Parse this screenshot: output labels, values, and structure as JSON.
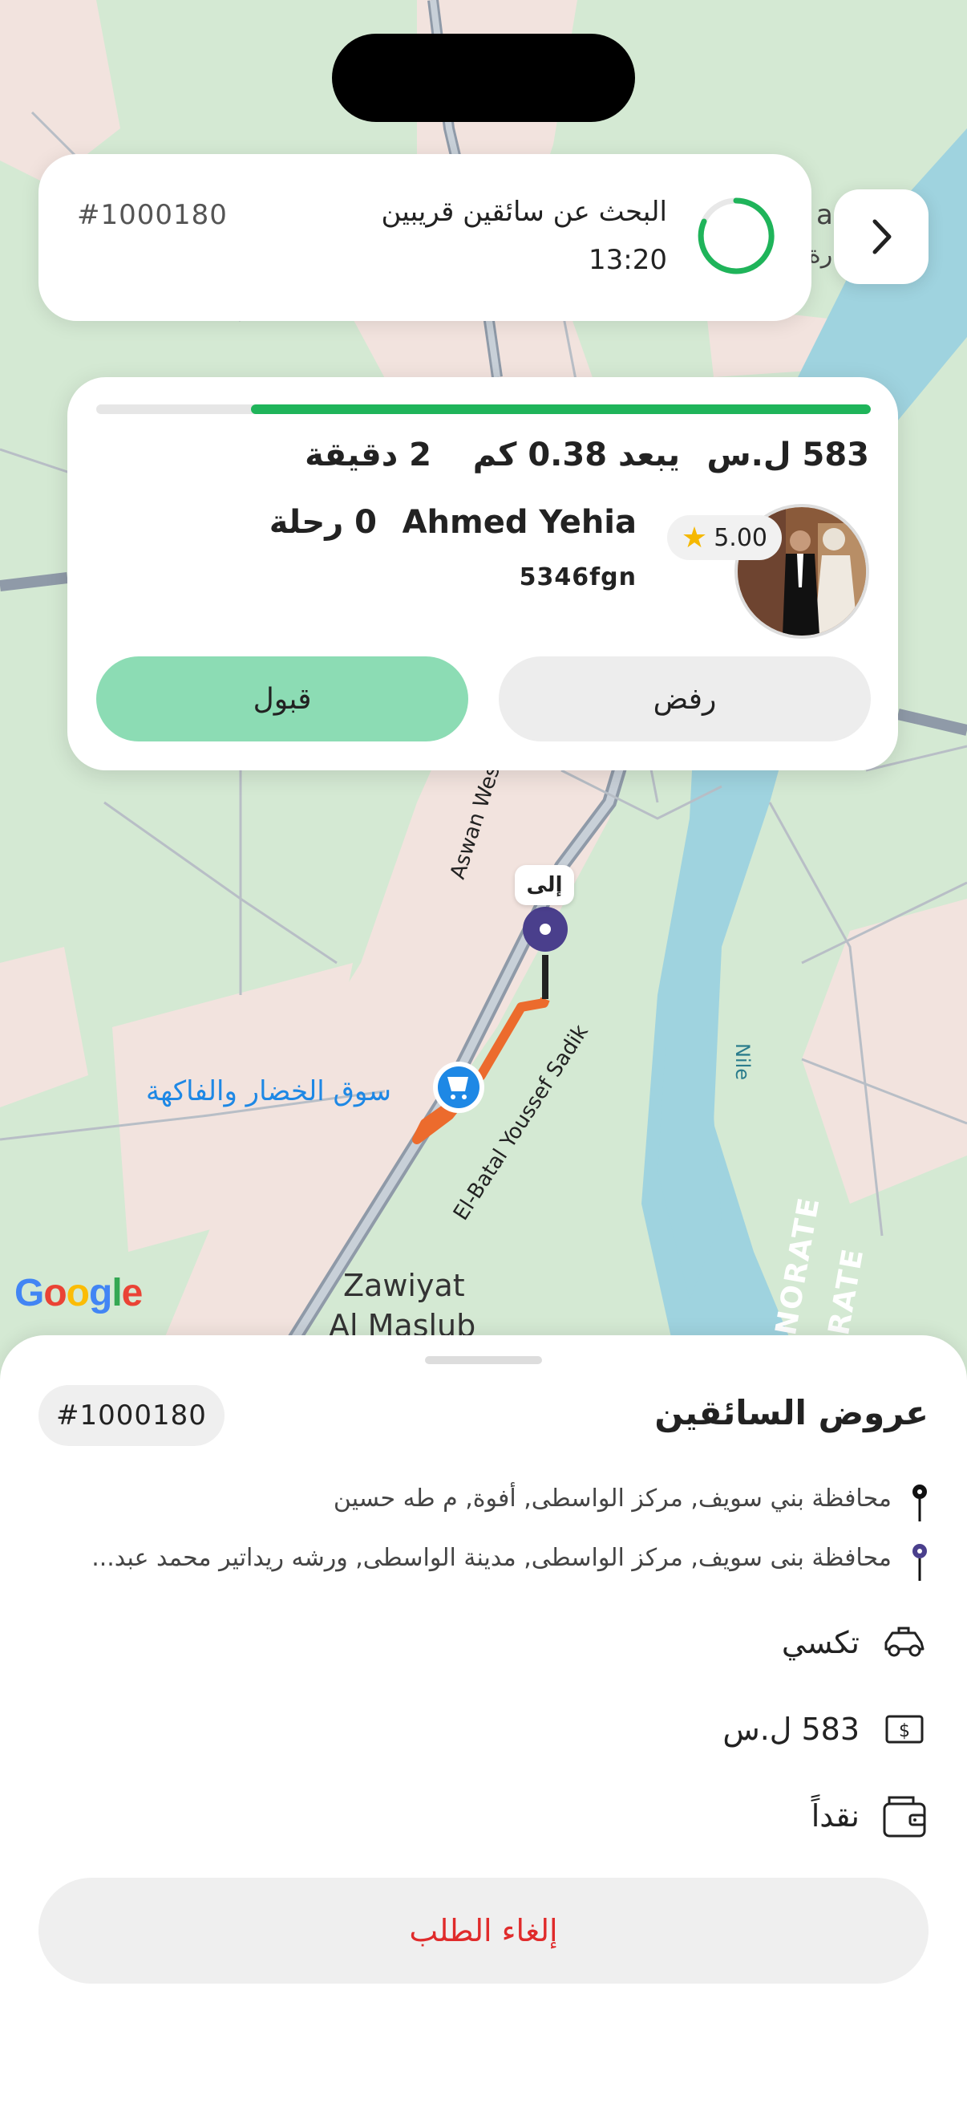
{
  "map": {
    "labels": {
      "road_west": "Aswan Western Agricu",
      "road_east": "El-Batal Youssef Sadik",
      "river": "Nile",
      "market": "سوق الخضار والفاكهة",
      "town_line1": "Zawiyat",
      "town_line2": "Al Maslub",
      "gov_1": "NORATE",
      "gov_2": "RATE",
      "edge_1": "a",
      "edge_2": "رة"
    },
    "dest_label": "إلى",
    "google_logo": [
      "G",
      "o",
      "o",
      "g",
      "l",
      "e"
    ],
    "google_colors": [
      "#4285F4",
      "#EA4335",
      "#FBBC05",
      "#4285F4",
      "#34A853",
      "#EA4335"
    ],
    "colors": {
      "land": "#d4e9d3",
      "urban": "#f2e3de",
      "water": "#9fd3df",
      "route": "#ec6b2d",
      "pin": "#4a3f8c"
    }
  },
  "search_card": {
    "order_id": "#1000180",
    "title": "البحث عن سائقين قريبين",
    "time": "13:20",
    "spinner_color": "#1fb45a"
  },
  "back_button": {
    "icon": "chevron-right-icon"
  },
  "offer": {
    "progress": 0.8,
    "price": "583 ل.س",
    "distance": "يبعد 0.38 كم",
    "eta": "2 دقيقة",
    "driver_name": "Ahmed Yehia",
    "trips": "0 رحلة",
    "plate": "5346fgn",
    "rating": "5.00",
    "reject_label": "رفض",
    "accept_label": "قبول",
    "accept_color": "#8cdcb4"
  },
  "sheet": {
    "title": "عروض السائقين",
    "order_id": "#1000180",
    "pickup_address": "محافظة بني سويف, مركز الواسطى, أفوة, م طه حسين",
    "dropoff_address": "محافظة بنى سويف, مركز الواسطى, مدينة الواسطى, ورشه ريداتير محمد عبد...",
    "vehicle": "تكسي",
    "fare": "583 ل.س",
    "payment": "نقداً",
    "cancel_label": "إلغاء الطلب",
    "cancel_color": "#e02b2b"
  }
}
